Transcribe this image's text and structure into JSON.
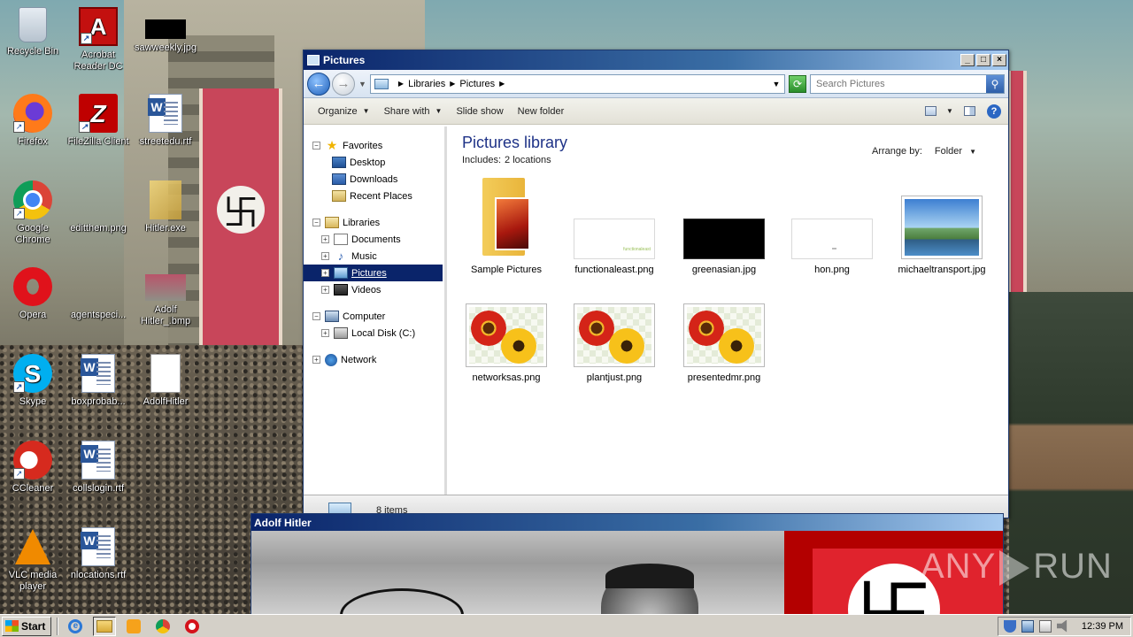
{
  "desktop": {
    "icons": [
      {
        "label": "Recycle Bin"
      },
      {
        "label": "Acrobat Reader DC"
      },
      {
        "label": "sawweekly.jpg"
      },
      {
        "label": "Firefox"
      },
      {
        "label": "FileZilla Client"
      },
      {
        "label": "streetedu.rtf"
      },
      {
        "label": "Google Chrome"
      },
      {
        "label": "editthem.png"
      },
      {
        "label": "Hitler.exe"
      },
      {
        "label": "Opera"
      },
      {
        "label": "agentspeci..."
      },
      {
        "label": "Adolf Hitler_.bmp"
      },
      {
        "label": "Skype"
      },
      {
        "label": "boxprobab..."
      },
      {
        "label": "AdolfHitler"
      },
      {
        "label": "CCleaner"
      },
      {
        "label": "collslogin.rtf"
      },
      {
        "label": "VLC media player"
      },
      {
        "label": "nlocations.rtf"
      }
    ]
  },
  "explorer": {
    "title": "Pictures",
    "breadcrumb": [
      "Libraries",
      "Pictures"
    ],
    "search_placeholder": "Search Pictures",
    "commands": [
      "Organize",
      "Share with",
      "Slide show",
      "New folder"
    ],
    "nav": {
      "favorites": {
        "label": "Favorites",
        "items": [
          "Desktop",
          "Downloads",
          "Recent Places"
        ]
      },
      "libraries": {
        "label": "Libraries",
        "items": [
          "Documents",
          "Music",
          "Pictures",
          "Videos"
        ],
        "selected": "Pictures"
      },
      "computer": {
        "label": "Computer",
        "items": [
          "Local Disk (C:)"
        ]
      },
      "network": {
        "label": "Network"
      }
    },
    "library_title": "Pictures library",
    "includes_label": "Includes:",
    "includes_value": "2 locations",
    "arrange_label": "Arrange by:",
    "arrange_value": "Folder",
    "files": [
      {
        "name": "Sample Pictures",
        "kind": "folder"
      },
      {
        "name": "functionaleast.png",
        "kind": "white"
      },
      {
        "name": "greenasian.jpg",
        "kind": "black"
      },
      {
        "name": "hon.png",
        "kind": "white2"
      },
      {
        "name": "michaeltransport.jpg",
        "kind": "landscape"
      },
      {
        "name": "networksas.png",
        "kind": "flower"
      },
      {
        "name": "plantjust.png",
        "kind": "flower"
      },
      {
        "name": "presentedmr.png",
        "kind": "flower"
      }
    ],
    "status": "8 items"
  },
  "viewer": {
    "title": "Adolf Hitler"
  },
  "watermark": {
    "left": "ANY",
    "right": "RUN"
  },
  "taskbar": {
    "start_label": "Start",
    "clock": "12:39 PM"
  }
}
